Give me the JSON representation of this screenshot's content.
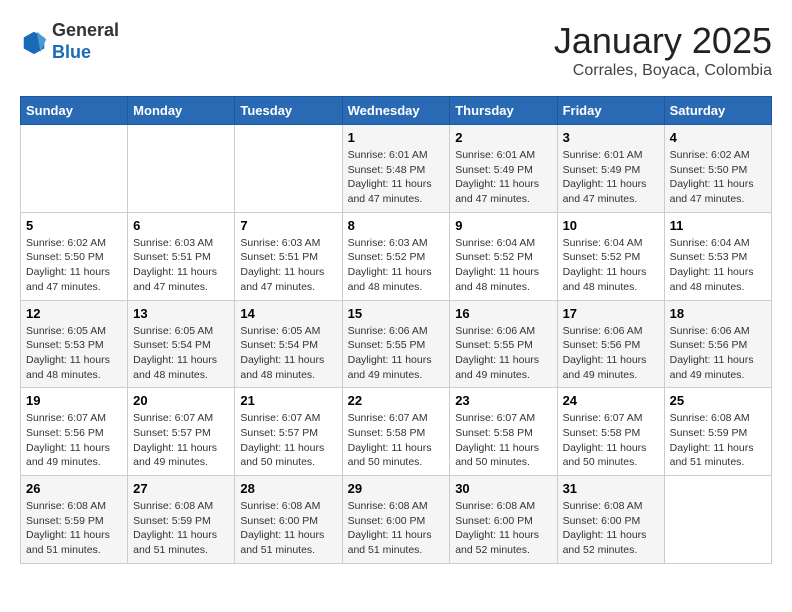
{
  "logo": {
    "general": "General",
    "blue": "Blue"
  },
  "header": {
    "title": "January 2025",
    "subtitle": "Corrales, Boyaca, Colombia"
  },
  "days_of_week": [
    "Sunday",
    "Monday",
    "Tuesday",
    "Wednesday",
    "Thursday",
    "Friday",
    "Saturday"
  ],
  "weeks": [
    [
      {
        "day": "",
        "info": ""
      },
      {
        "day": "",
        "info": ""
      },
      {
        "day": "",
        "info": ""
      },
      {
        "day": "1",
        "info": "Sunrise: 6:01 AM\nSunset: 5:48 PM\nDaylight: 11 hours and 47 minutes."
      },
      {
        "day": "2",
        "info": "Sunrise: 6:01 AM\nSunset: 5:49 PM\nDaylight: 11 hours and 47 minutes."
      },
      {
        "day": "3",
        "info": "Sunrise: 6:01 AM\nSunset: 5:49 PM\nDaylight: 11 hours and 47 minutes."
      },
      {
        "day": "4",
        "info": "Sunrise: 6:02 AM\nSunset: 5:50 PM\nDaylight: 11 hours and 47 minutes."
      }
    ],
    [
      {
        "day": "5",
        "info": "Sunrise: 6:02 AM\nSunset: 5:50 PM\nDaylight: 11 hours and 47 minutes."
      },
      {
        "day": "6",
        "info": "Sunrise: 6:03 AM\nSunset: 5:51 PM\nDaylight: 11 hours and 47 minutes."
      },
      {
        "day": "7",
        "info": "Sunrise: 6:03 AM\nSunset: 5:51 PM\nDaylight: 11 hours and 47 minutes."
      },
      {
        "day": "8",
        "info": "Sunrise: 6:03 AM\nSunset: 5:52 PM\nDaylight: 11 hours and 48 minutes."
      },
      {
        "day": "9",
        "info": "Sunrise: 6:04 AM\nSunset: 5:52 PM\nDaylight: 11 hours and 48 minutes."
      },
      {
        "day": "10",
        "info": "Sunrise: 6:04 AM\nSunset: 5:52 PM\nDaylight: 11 hours and 48 minutes."
      },
      {
        "day": "11",
        "info": "Sunrise: 6:04 AM\nSunset: 5:53 PM\nDaylight: 11 hours and 48 minutes."
      }
    ],
    [
      {
        "day": "12",
        "info": "Sunrise: 6:05 AM\nSunset: 5:53 PM\nDaylight: 11 hours and 48 minutes."
      },
      {
        "day": "13",
        "info": "Sunrise: 6:05 AM\nSunset: 5:54 PM\nDaylight: 11 hours and 48 minutes."
      },
      {
        "day": "14",
        "info": "Sunrise: 6:05 AM\nSunset: 5:54 PM\nDaylight: 11 hours and 48 minutes."
      },
      {
        "day": "15",
        "info": "Sunrise: 6:06 AM\nSunset: 5:55 PM\nDaylight: 11 hours and 49 minutes."
      },
      {
        "day": "16",
        "info": "Sunrise: 6:06 AM\nSunset: 5:55 PM\nDaylight: 11 hours and 49 minutes."
      },
      {
        "day": "17",
        "info": "Sunrise: 6:06 AM\nSunset: 5:56 PM\nDaylight: 11 hours and 49 minutes."
      },
      {
        "day": "18",
        "info": "Sunrise: 6:06 AM\nSunset: 5:56 PM\nDaylight: 11 hours and 49 minutes."
      }
    ],
    [
      {
        "day": "19",
        "info": "Sunrise: 6:07 AM\nSunset: 5:56 PM\nDaylight: 11 hours and 49 minutes."
      },
      {
        "day": "20",
        "info": "Sunrise: 6:07 AM\nSunset: 5:57 PM\nDaylight: 11 hours and 49 minutes."
      },
      {
        "day": "21",
        "info": "Sunrise: 6:07 AM\nSunset: 5:57 PM\nDaylight: 11 hours and 50 minutes."
      },
      {
        "day": "22",
        "info": "Sunrise: 6:07 AM\nSunset: 5:58 PM\nDaylight: 11 hours and 50 minutes."
      },
      {
        "day": "23",
        "info": "Sunrise: 6:07 AM\nSunset: 5:58 PM\nDaylight: 11 hours and 50 minutes."
      },
      {
        "day": "24",
        "info": "Sunrise: 6:07 AM\nSunset: 5:58 PM\nDaylight: 11 hours and 50 minutes."
      },
      {
        "day": "25",
        "info": "Sunrise: 6:08 AM\nSunset: 5:59 PM\nDaylight: 11 hours and 51 minutes."
      }
    ],
    [
      {
        "day": "26",
        "info": "Sunrise: 6:08 AM\nSunset: 5:59 PM\nDaylight: 11 hours and 51 minutes."
      },
      {
        "day": "27",
        "info": "Sunrise: 6:08 AM\nSunset: 5:59 PM\nDaylight: 11 hours and 51 minutes."
      },
      {
        "day": "28",
        "info": "Sunrise: 6:08 AM\nSunset: 6:00 PM\nDaylight: 11 hours and 51 minutes."
      },
      {
        "day": "29",
        "info": "Sunrise: 6:08 AM\nSunset: 6:00 PM\nDaylight: 11 hours and 51 minutes."
      },
      {
        "day": "30",
        "info": "Sunrise: 6:08 AM\nSunset: 6:00 PM\nDaylight: 11 hours and 52 minutes."
      },
      {
        "day": "31",
        "info": "Sunrise: 6:08 AM\nSunset: 6:00 PM\nDaylight: 11 hours and 52 minutes."
      },
      {
        "day": "",
        "info": ""
      }
    ]
  ]
}
